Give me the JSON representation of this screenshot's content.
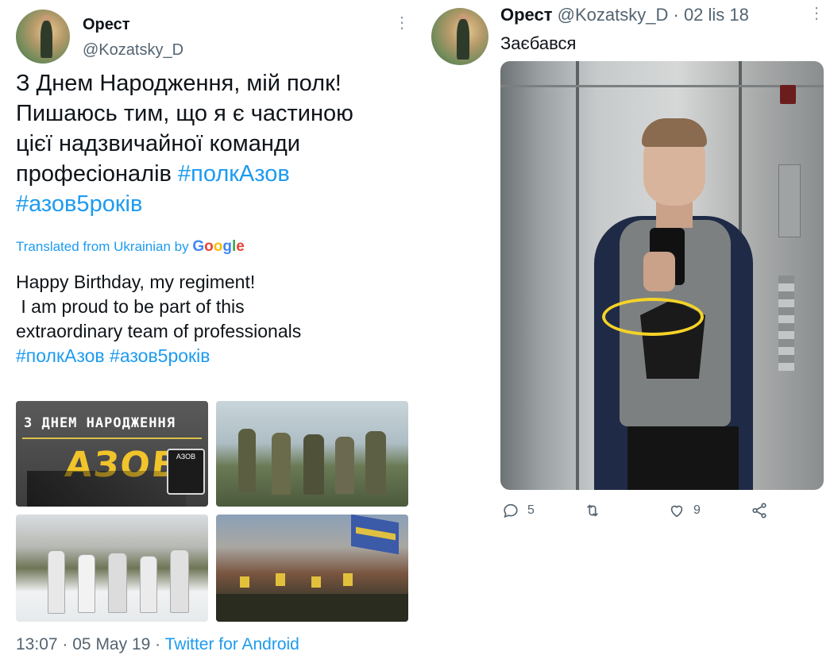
{
  "left_tweet": {
    "author_name": "Орест",
    "author_handle": "@Kozatsky_D",
    "text_lines": [
      "З Днем Народження, мій полк!",
      "Пишаюсь тим, що я є частиною",
      "цієї надзвичайної команди"
    ],
    "text_line4_prefix": "професіоналів ",
    "hashtag_1": "#полкАзов",
    "hashtag_2": "#азов5років",
    "translation_label": "Translated from Ukrainian by",
    "translation_provider": "Google",
    "translated_lines": [
      "Happy Birthday, my regiment!",
      " I am proud to be part of this",
      "extraordinary team of professionals"
    ],
    "translated_hashtags": "#полкАзов #азов5років",
    "media": [
      {
        "name": "azov-banner-image",
        "overlay_title": "З ДНЕМ НАРОДЖЕННЯ",
        "overlay_big": "АЗОВ",
        "overlay_badge": "АЗОВ"
      },
      {
        "name": "soldiers-group-photo"
      },
      {
        "name": "winter-soldiers-photo"
      },
      {
        "name": "march-flags-photo"
      }
    ],
    "time": "13:07",
    "date": "05 May 19",
    "source": "Twitter for Android",
    "separator": "·"
  },
  "right_tweet": {
    "author_name": "Орест",
    "author_handle": "@Kozatsky_D",
    "separator": "·",
    "date": "02 lis 18",
    "text": "Заєбався",
    "media_name": "elevator-selfie-photo",
    "actions": {
      "reply_count": "5",
      "retweet_count": "",
      "like_count": "9",
      "share_count": ""
    }
  },
  "colors": {
    "link": "#1d9bf0",
    "secondary_text": "#536471",
    "highlight_circle": "#f5d327"
  },
  "icons": [
    "more-icon",
    "reply-icon",
    "retweet-icon",
    "like-icon",
    "share-icon"
  ]
}
